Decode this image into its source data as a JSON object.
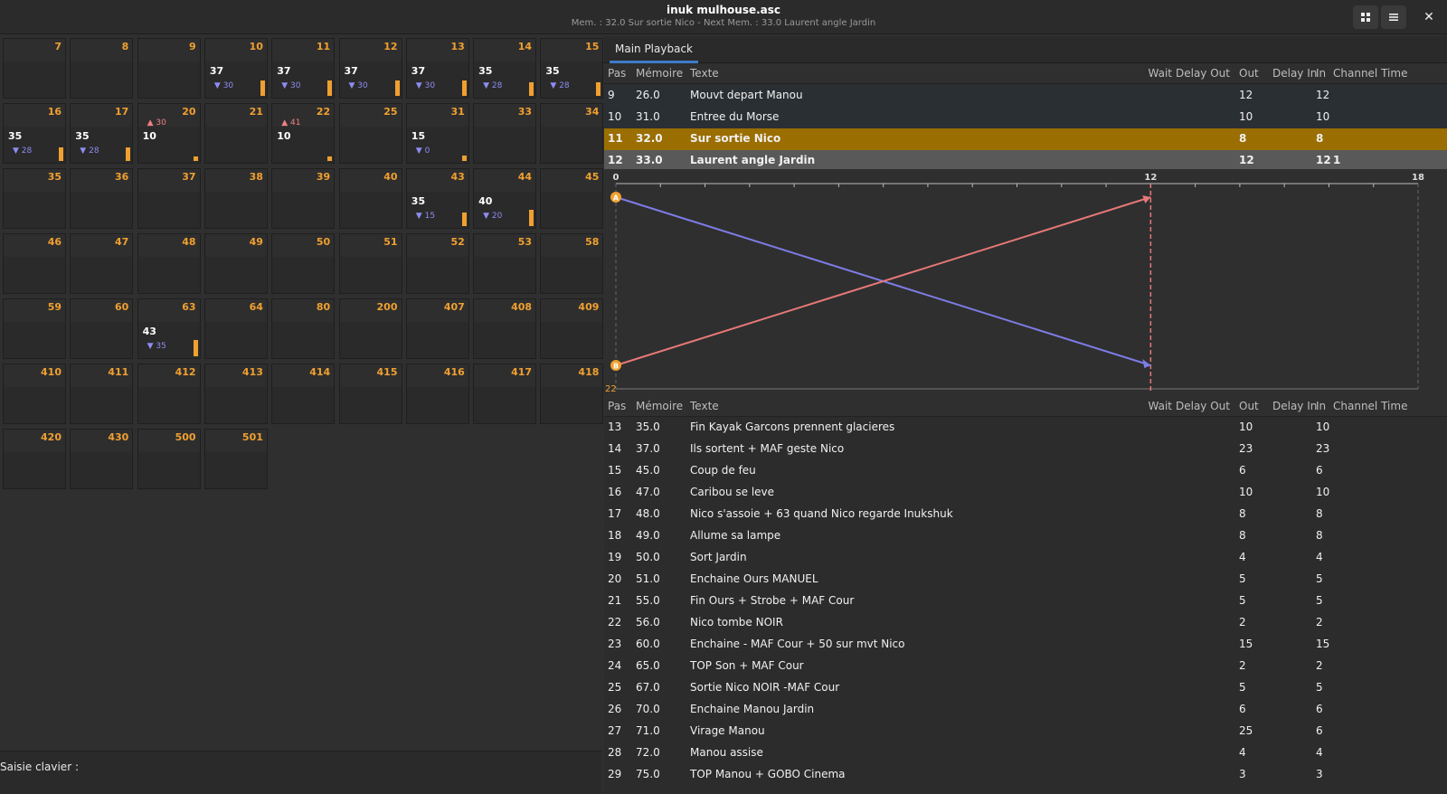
{
  "window": {
    "title": "inuk mulhouse.asc",
    "subtitle": "Mem. : 32.0 Sur sortie Nico - Next Mem. : 33.0 Laurent angle Jardin",
    "grid_button_icon": "grid-icon",
    "menu_button_icon": "hamburger-menu-icon",
    "close_label": "✕"
  },
  "channels": [
    {
      "num": "7"
    },
    {
      "num": "8"
    },
    {
      "num": "9"
    },
    {
      "num": "10",
      "level": "37",
      "next": "30",
      "bar": 0.55
    },
    {
      "num": "11",
      "level": "37",
      "next": "30",
      "bar": 0.55
    },
    {
      "num": "12",
      "level": "37",
      "next": "30",
      "bar": 0.55
    },
    {
      "num": "13",
      "level": "37",
      "next": "30",
      "bar": 0.55
    },
    {
      "num": "14",
      "level": "35",
      "next": "28",
      "bar": 0.5
    },
    {
      "num": "15",
      "level": "35",
      "next": "28",
      "bar": 0.5
    },
    {
      "num": "16",
      "level": "35",
      "next": "28",
      "bar": 0.5
    },
    {
      "num": "17",
      "level": "35",
      "next": "28",
      "bar": 0.5
    },
    {
      "num": "20",
      "level": "10",
      "up": "30",
      "bar": 0.15
    },
    {
      "num": "21"
    },
    {
      "num": "22",
      "level": "10",
      "up": "41",
      "bar": 0.15
    },
    {
      "num": "25"
    },
    {
      "num": "31",
      "level": "15",
      "next": "0",
      "bar": 0.2
    },
    {
      "num": "33"
    },
    {
      "num": "34"
    },
    {
      "num": "35"
    },
    {
      "num": "36"
    },
    {
      "num": "37"
    },
    {
      "num": "38"
    },
    {
      "num": "39"
    },
    {
      "num": "40"
    },
    {
      "num": "43",
      "level": "35",
      "next": "15",
      "bar": 0.5
    },
    {
      "num": "44",
      "level": "40",
      "next": "20",
      "bar": 0.6
    },
    {
      "num": "45"
    },
    {
      "num": "46"
    },
    {
      "num": "47"
    },
    {
      "num": "48"
    },
    {
      "num": "49"
    },
    {
      "num": "50"
    },
    {
      "num": "51"
    },
    {
      "num": "52"
    },
    {
      "num": "53"
    },
    {
      "num": "58"
    },
    {
      "num": "59"
    },
    {
      "num": "60"
    },
    {
      "num": "63",
      "level": "43",
      "next": "35",
      "bar": 0.6
    },
    {
      "num": "64"
    },
    {
      "num": "80"
    },
    {
      "num": "200"
    },
    {
      "num": "407"
    },
    {
      "num": "408"
    },
    {
      "num": "409"
    },
    {
      "num": "410"
    },
    {
      "num": "411"
    },
    {
      "num": "412"
    },
    {
      "num": "413"
    },
    {
      "num": "414"
    },
    {
      "num": "415"
    },
    {
      "num": "416"
    },
    {
      "num": "417"
    },
    {
      "num": "418"
    },
    {
      "num": "420"
    },
    {
      "num": "430"
    },
    {
      "num": "500"
    },
    {
      "num": "501"
    }
  ],
  "keyboard": {
    "label": "Saisie clavier :"
  },
  "playback": {
    "tab": "Main Playback",
    "headers": [
      "Pas",
      "Mémoire",
      "Texte",
      "Wait",
      "Delay Out",
      "Out",
      "Delay In",
      "In",
      "Channel Time"
    ],
    "upper_rows": [
      {
        "pas": "9",
        "mem": "26.0",
        "text": "Mouvt depart Manou",
        "wait": "",
        "dout": "",
        "out": "12",
        "din": "",
        "in": "12",
        "ct": "",
        "state": "normal"
      },
      {
        "pas": "10",
        "mem": "31.0",
        "text": "Entree du Morse",
        "wait": "",
        "dout": "",
        "out": "10",
        "din": "",
        "in": "10",
        "ct": "",
        "state": "normal"
      },
      {
        "pas": "11",
        "mem": "32.0",
        "text": "Sur sortie Nico",
        "wait": "",
        "dout": "",
        "out": "8",
        "din": "",
        "in": "8",
        "ct": "",
        "state": "current"
      },
      {
        "pas": "12",
        "mem": "33.0",
        "text": "Laurent angle Jardin",
        "wait": "",
        "dout": "",
        "out": "12",
        "din": "",
        "in": "12",
        "ct": "1",
        "state": "next"
      }
    ],
    "lower_rows": [
      {
        "pas": "13",
        "mem": "35.0",
        "text": "Fin Kayak Garcons prennent glacieres",
        "out": "10",
        "in": "10"
      },
      {
        "pas": "14",
        "mem": "37.0",
        "text": "Ils sortent + MAF geste Nico",
        "out": "23",
        "in": "23"
      },
      {
        "pas": "15",
        "mem": "45.0",
        "text": "Coup de feu",
        "out": "6",
        "in": "6"
      },
      {
        "pas": "16",
        "mem": "47.0",
        "text": "Caribou se leve",
        "out": "10",
        "in": "10"
      },
      {
        "pas": "17",
        "mem": "48.0",
        "text": "Nico s'assoie + 63 quand Nico regarde Inukshuk",
        "out": "8",
        "in": "8"
      },
      {
        "pas": "18",
        "mem": "49.0",
        "text": "Allume sa lampe",
        "out": "8",
        "in": "8"
      },
      {
        "pas": "19",
        "mem": "50.0",
        "text": "Sort Jardin",
        "out": "4",
        "in": "4"
      },
      {
        "pas": "20",
        "mem": "51.0",
        "text": "Enchaine Ours MANUEL",
        "out": "5",
        "in": "5"
      },
      {
        "pas": "21",
        "mem": "55.0",
        "text": "Fin Ours + Strobe + MAF Cour",
        "out": "5",
        "in": "5"
      },
      {
        "pas": "22",
        "mem": "56.0",
        "text": "Nico tombe NOIR",
        "out": "2",
        "in": "2"
      },
      {
        "pas": "23",
        "mem": "60.0",
        "text": "Enchaine - MAF Cour + 50 sur mvt Nico",
        "out": "15",
        "in": "15"
      },
      {
        "pas": "24",
        "mem": "65.0",
        "text": "TOP Son + MAF Cour",
        "out": "2",
        "in": "2"
      },
      {
        "pas": "25",
        "mem": "67.0",
        "text": "Sortie Nico NOIR -MAF Cour",
        "out": "5",
        "in": "5"
      },
      {
        "pas": "26",
        "mem": "70.0",
        "text": "Enchaine Manou Jardin",
        "out": "6",
        "in": "6"
      },
      {
        "pas": "27",
        "mem": "71.0",
        "text": "Virage Manou",
        "out": "25",
        "in": "6"
      },
      {
        "pas": "28",
        "mem": "72.0",
        "text": "Manou assise",
        "out": "4",
        "in": "4"
      },
      {
        "pas": "29",
        "mem": "75.0",
        "text": "TOP Manou + GOBO Cinema",
        "out": "3",
        "in": "3"
      }
    ],
    "timeline": {
      "max_time": 18,
      "labeled_ticks": [
        "0",
        "12",
        "18"
      ],
      "marker_time": 12,
      "out_time": 12,
      "in_time": 12,
      "bottom_label": "22",
      "point_a": "A",
      "point_b": "B",
      "colors": {
        "out": "#7d7de8",
        "in": "#e87878",
        "accent": "#f0a030"
      }
    },
    "colors": {
      "current_row": "#9a6e00",
      "next_row": "#595959"
    }
  }
}
